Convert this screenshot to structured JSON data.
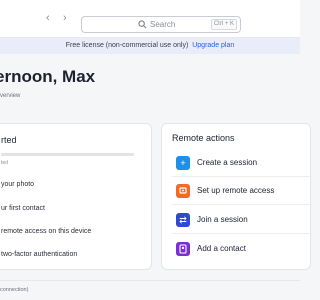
{
  "search": {
    "placeholder": "Search",
    "shortcut": "Ctrl + K"
  },
  "banner": {
    "text": "Free license (non-commercial use only)",
    "link": "Upgrade plan"
  },
  "greeting": {
    "title": "ernoon, Max",
    "subtitle": "verview"
  },
  "getting_started": {
    "title": "rted",
    "progress_label": "ted",
    "progress_fraction": 0.0,
    "steps": [
      {
        "label": "your photo"
      },
      {
        "label": "ur first contact"
      },
      {
        "label": "remote access on this device"
      },
      {
        "label": "two-factor authentication"
      }
    ]
  },
  "remote_actions": {
    "title": "Remote actions",
    "items": [
      {
        "label": "Create a session",
        "icon": "plus-icon",
        "color": "#1f8fe8"
      },
      {
        "label": "Set up remote access",
        "icon": "remote-access-icon",
        "color": "#f06a2a"
      },
      {
        "label": "Join a session",
        "icon": "swap-arrows-icon",
        "color": "#2f49d1"
      },
      {
        "label": "Add a contact",
        "icon": "contact-icon",
        "color": "#7b2fd0"
      }
    ]
  },
  "footer": {
    "text": "connection)"
  }
}
